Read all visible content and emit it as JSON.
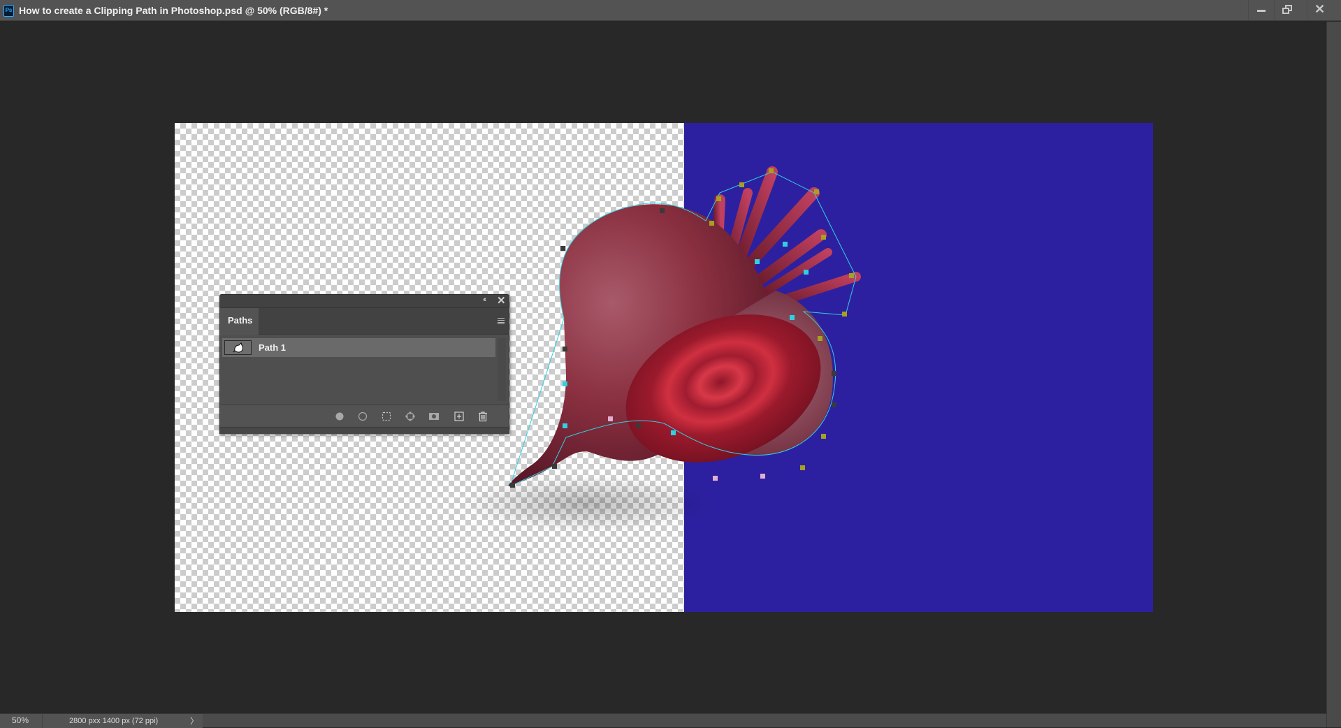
{
  "window": {
    "app_icon": "photoshop-icon",
    "app_icon_text": "Ps",
    "title": "How to create a Clipping Path in Photoshop.psd @ 50% (RGB/8#) *",
    "controls": {
      "minimize": "minimize-icon",
      "restore": "restore-icon",
      "close": "✕"
    }
  },
  "document": {
    "background_split": {
      "left": "transparent-checkerboard",
      "right_color": "#2d20a0"
    },
    "subject": "beetroot with clipping path anchor points"
  },
  "paths_panel": {
    "collapse_label": "‹‹",
    "close_label": "✕",
    "tabs": [
      {
        "label": "Paths",
        "active": true
      }
    ],
    "menu_icon": "panel-menu-icon",
    "paths": [
      {
        "name": "Path 1",
        "selected": true
      }
    ],
    "footer_buttons": [
      {
        "name": "fill-path",
        "tooltip": "Fill path with foreground color"
      },
      {
        "name": "stroke-path",
        "tooltip": "Stroke path with brush"
      },
      {
        "name": "load-as-selection",
        "tooltip": "Load path as a selection"
      },
      {
        "name": "make-work-path",
        "tooltip": "Make work path from selection"
      },
      {
        "name": "add-mask",
        "tooltip": "Add a mask"
      },
      {
        "name": "create-new-path",
        "tooltip": "Create new path"
      },
      {
        "name": "delete-path",
        "tooltip": "Delete current path"
      }
    ]
  },
  "statusbar": {
    "zoom": "50%",
    "doc_info": "2800 pxx 1400 px (72 ppi)",
    "arrow": "〉"
  },
  "colors": {
    "accent_blue": "#2d20a0",
    "anchor_olive": "#a8a020",
    "anchor_cyan": "#30d0e0",
    "anchor_pink": "#e0b0d0"
  }
}
